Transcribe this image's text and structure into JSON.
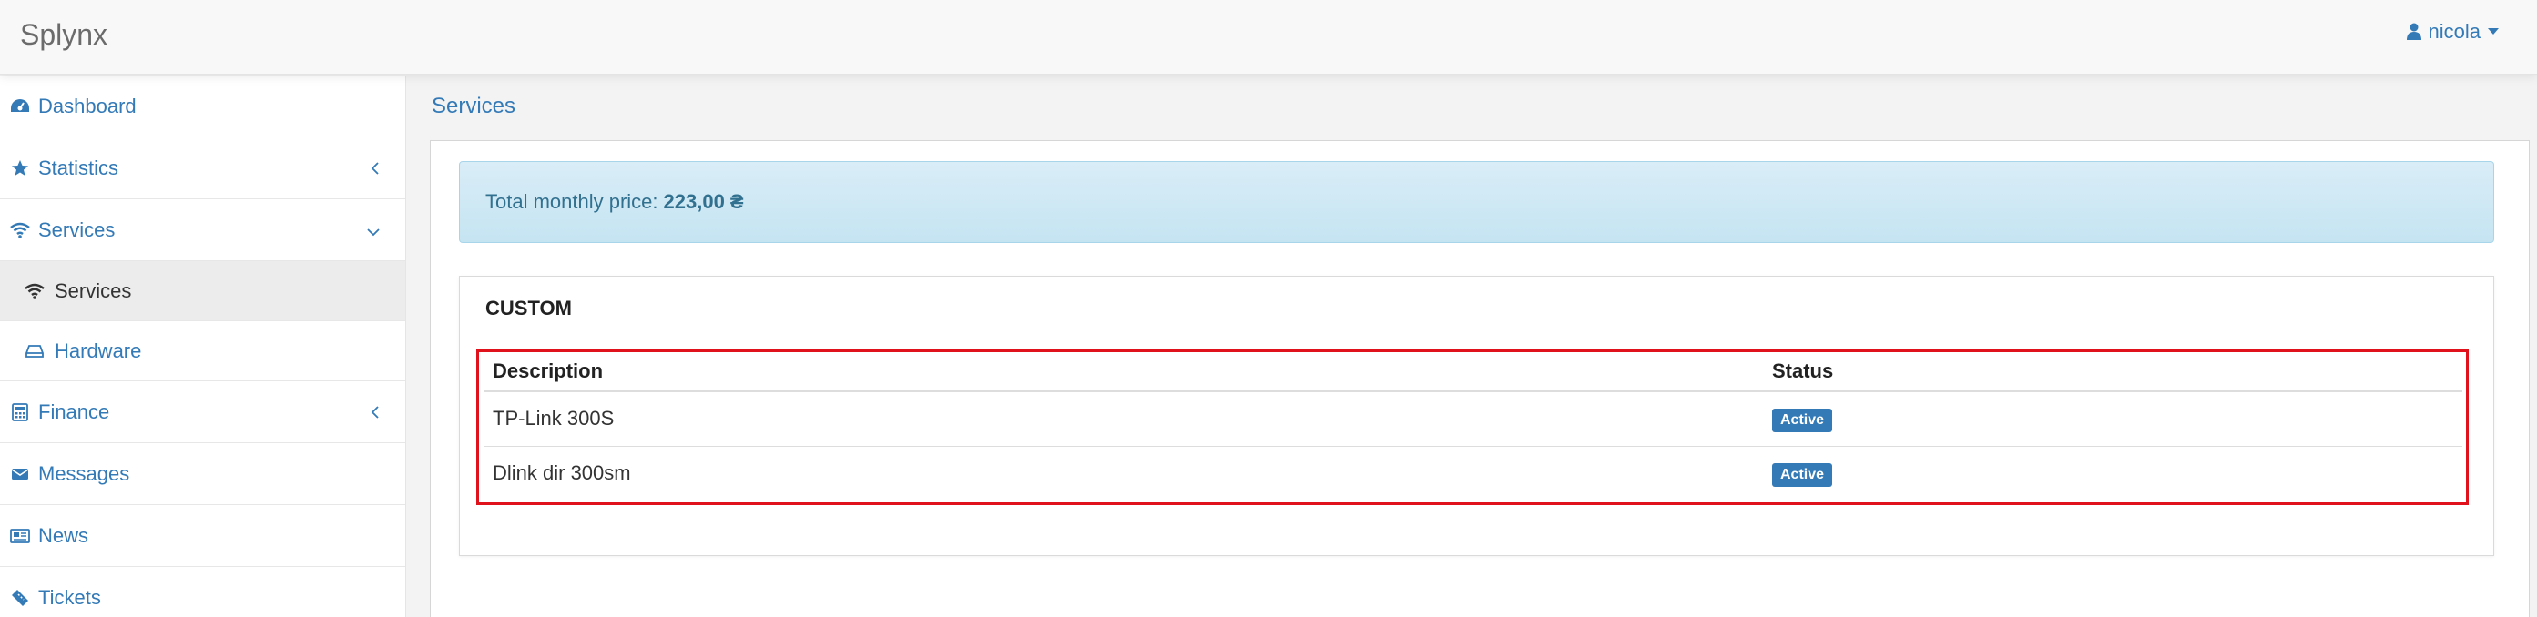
{
  "header": {
    "brand": "Splynx",
    "user": "nicola"
  },
  "sidebar": {
    "items": [
      {
        "label": "Dashboard"
      },
      {
        "label": "Statistics"
      },
      {
        "label": "Services"
      },
      {
        "label": "Services"
      },
      {
        "label": "Hardware"
      },
      {
        "label": "Finance"
      },
      {
        "label": "Messages"
      },
      {
        "label": "News"
      },
      {
        "label": "Tickets"
      }
    ]
  },
  "main": {
    "title": "Services",
    "summary": {
      "label": "Total monthly price:",
      "value": "223,00 ₴"
    },
    "box": {
      "title": "CUSTOM",
      "columns": [
        "Description",
        "Status"
      ],
      "rows": [
        {
          "description": "TP-Link 300S",
          "status": "Active"
        },
        {
          "description": "Dlink dir 300sm",
          "status": "Active"
        }
      ]
    }
  },
  "colors": {
    "accent": "#337ab7",
    "highlight": "#e0121b",
    "info_bg": "#d9edf7"
  }
}
